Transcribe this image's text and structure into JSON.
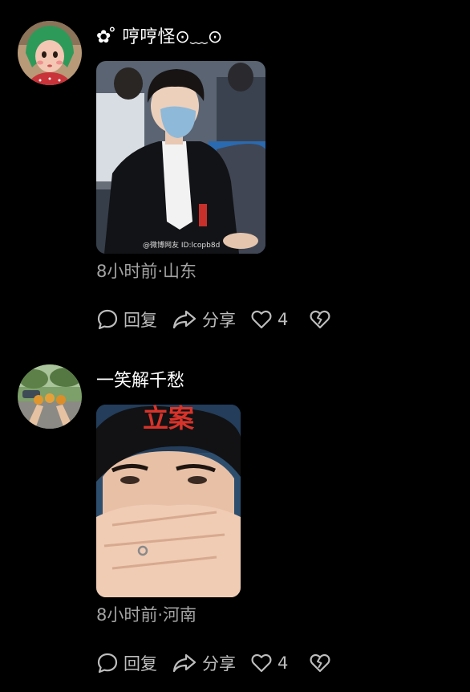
{
  "comments": [
    {
      "username": "✿ ̊ 哼哼怪⊙﹏⊙",
      "time_location": "8小时前·山东",
      "reply_label": "回复",
      "share_label": "分享",
      "like_count": "4",
      "photo_watermark": "@微博网友 ID:lcopb8d"
    },
    {
      "username": "一笑解千愁",
      "time_location": "8小时前·河南",
      "reply_label": "回复",
      "share_label": "分享",
      "like_count": "4",
      "photo_overlay_text": "立案"
    }
  ],
  "icons": {
    "reply": "speech-bubble-icon",
    "share": "share-arrow-icon",
    "like": "heart-icon",
    "dislike": "broken-heart-icon"
  },
  "colors": {
    "background": "#000000",
    "username": "#ffffff",
    "meta": "#a3a3a3",
    "action": "#bdbdbd",
    "overlay_red": "#d8332a"
  }
}
